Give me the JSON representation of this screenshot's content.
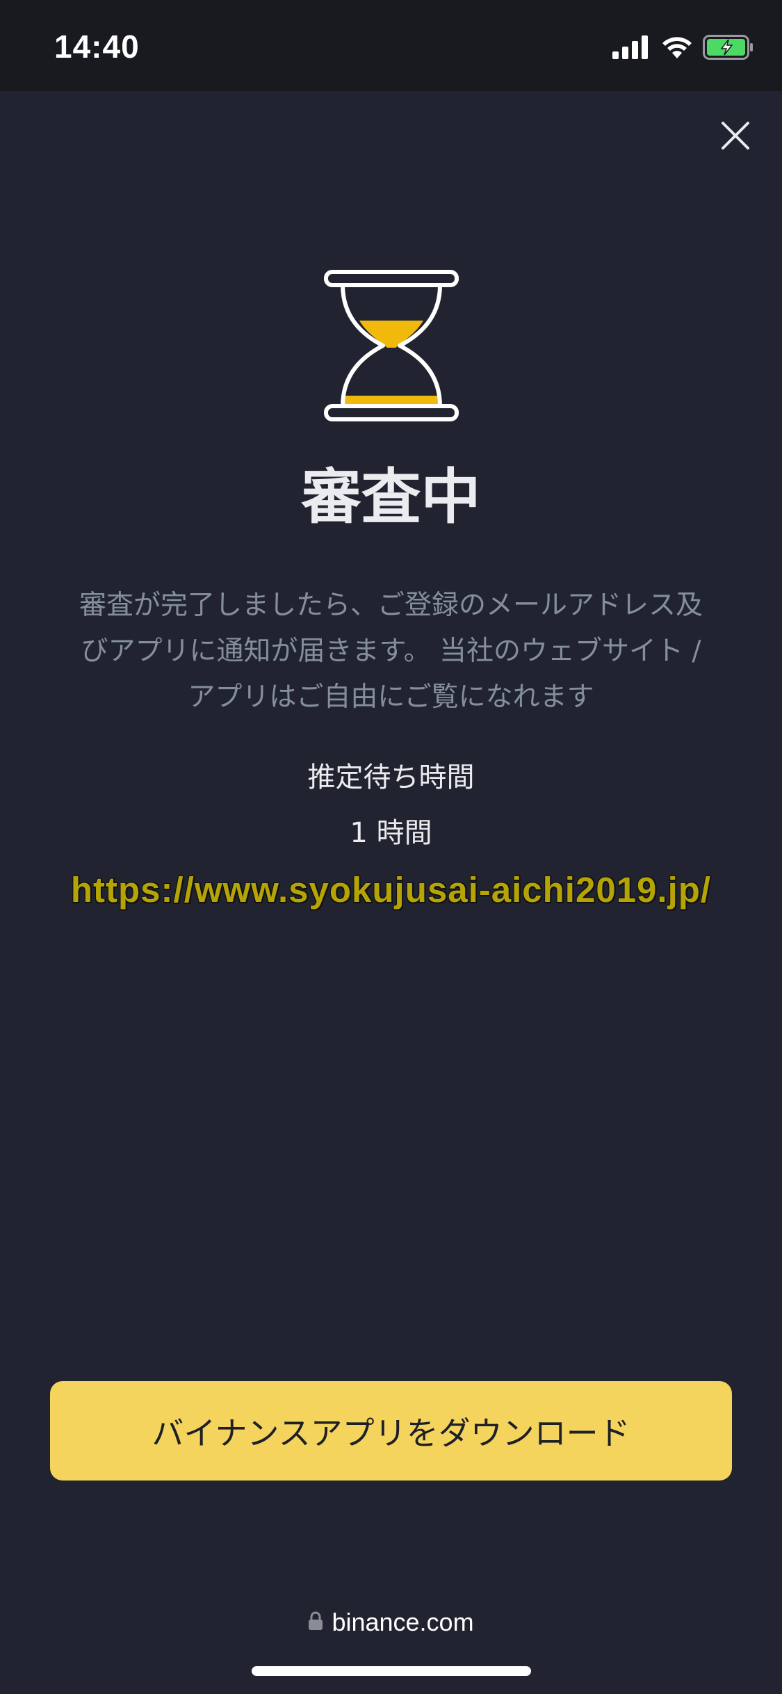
{
  "status_bar": {
    "time": "14:40"
  },
  "icons": {
    "close": "close-icon",
    "hourglass": "hourglass-icon",
    "lock": "lock-icon",
    "signal": "cellular-signal-icon",
    "wifi": "wifi-icon",
    "battery": "battery-charging-icon"
  },
  "review": {
    "title": "審査中",
    "description_lines": [
      "審査が完了しましたら、ご登録のメールアドレス及",
      "びアプリに通知が届きます。 当社のウェブサイト /",
      "アプリはご自由にご覧になれます"
    ],
    "estimated_wait_label": "推定待ち時間",
    "estimated_wait_value": "1 時間"
  },
  "watermark_text": "https://www.syokujusai-aichi2019.jp/",
  "actions": {
    "download_label": "バイナンスアプリをダウンロード"
  },
  "browser": {
    "domain": "binance.com"
  },
  "colors": {
    "background": "#212430",
    "status_bar_bg": "#191a1f",
    "accent_yellow": "#f5d45e",
    "primary_text": "#eaecef",
    "secondary_text": "#848e9c",
    "battery_green": "#4cd964",
    "watermark": "#b5a405"
  }
}
